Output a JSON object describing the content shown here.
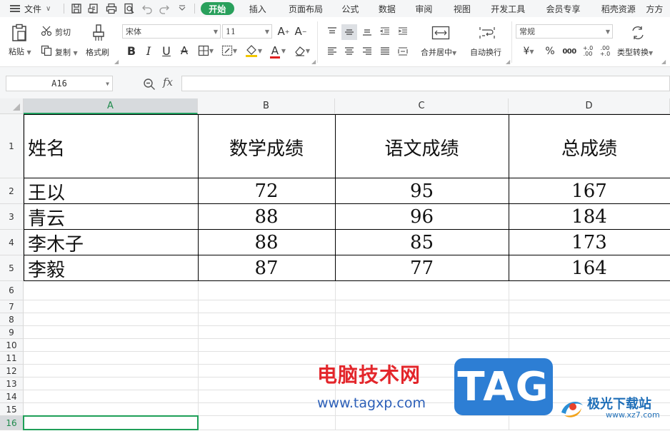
{
  "menu": {
    "file_label": "文件",
    "tabs": [
      "开始",
      "插入",
      "页面布局",
      "公式",
      "数据",
      "审阅",
      "视图",
      "开发工具",
      "会员专享",
      "稻壳资源",
      "方方"
    ],
    "active_tab": "开始"
  },
  "ribbon": {
    "paste_label": "粘贴",
    "cut_label": "剪切",
    "copy_label": "复制",
    "format_painter_label": "格式刷",
    "font_name": "宋体",
    "font_size": "11",
    "merge_center_label": "合并居中",
    "wrap_text_label": "自动换行",
    "number_format": "常规",
    "type_convert_label": "类型转换",
    "currency_symbol": "¥",
    "percent_symbol": "%",
    "thousands_symbol": "000",
    "inc_decimal": "+.0 .00",
    "dec_decimal": ".00 +.0",
    "bold": "B",
    "italic": "I",
    "underline": "U",
    "font_color_letter": "A",
    "strike_letter": "A"
  },
  "formula_bar": {
    "cell_ref": "A16",
    "fx": "fx",
    "formula": ""
  },
  "sheet": {
    "columns": [
      "A",
      "B",
      "C",
      "D"
    ],
    "selected_column": "A",
    "rows": [
      "1",
      "2",
      "3",
      "4",
      "5",
      "6",
      "7",
      "8",
      "9",
      "10",
      "11",
      "12",
      "13",
      "14",
      "15",
      "16"
    ],
    "selected_row": "16",
    "header": [
      "姓名",
      "数学成绩",
      "语文成绩",
      "总成绩"
    ],
    "data": [
      [
        "王以",
        "72",
        "95",
        "167"
      ],
      [
        "青云",
        "88",
        "96",
        "184"
      ],
      [
        "李木子",
        "88",
        "85",
        "173"
      ],
      [
        "李毅",
        "87",
        "77",
        "164"
      ]
    ]
  },
  "watermark": {
    "site_name": "电脑技术网",
    "site_url": "www.tagxp.com",
    "tag": "TAG",
    "brand": "极光下载站",
    "brand_domain": "www.xz7.com"
  }
}
